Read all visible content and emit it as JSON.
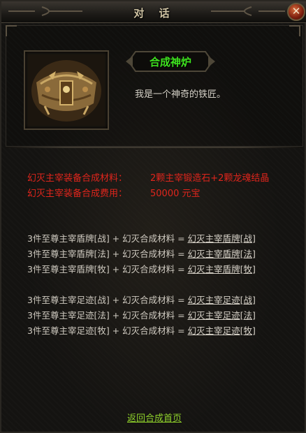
{
  "window": {
    "title": "对 话",
    "close_label": "✕"
  },
  "npc": {
    "name": "合成神炉",
    "description": "我是一个神奇的铁匠。"
  },
  "materials": {
    "label": "幻灭主宰装备合成材料：",
    "value": "2颗主宰锻造石+2颗龙魂结晶"
  },
  "cost": {
    "label": "幻灭主宰装备合成费用：",
    "value": "50000 元宝"
  },
  "recipes": [
    {
      "input": "3件至尊主宰盾牌[战] + 幻灭合成材料 = ",
      "result": "幻灭主宰盾牌[战]"
    },
    {
      "input": "3件至尊主宰盾牌[法] + 幻灭合成材料 = ",
      "result": "幻灭主宰盾牌[法]"
    },
    {
      "input": "3件至尊主宰盾牌[牧] + 幻灭合成材料 = ",
      "result": "幻灭主宰盾牌[牧]"
    },
    {
      "input": "3件至尊主宰足迹[战] + 幻灭合成材料 = ",
      "result": "幻灭主宰足迹[战]"
    },
    {
      "input": "3件至尊主宰足迹[法] + 幻灭合成材料 = ",
      "result": "幻灭主宰足迹[法]"
    },
    {
      "input": "3件至尊主宰足迹[牧] + 幻灭合成材料 = ",
      "result": "幻灭主宰足迹[牧]"
    }
  ],
  "footer": {
    "back_link": "返回合成首页"
  },
  "colors": {
    "npc_name": "#3ee21f",
    "warning": "#e0251c",
    "link": "#8fd12b",
    "text": "#cfcac0"
  }
}
